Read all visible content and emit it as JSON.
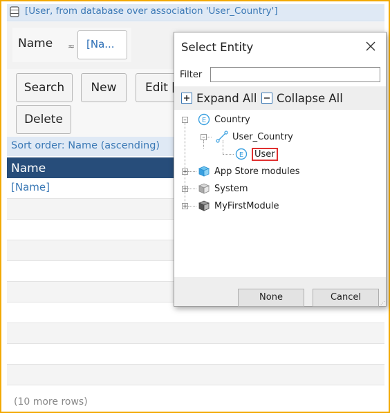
{
  "datagrid": {
    "header_title": "[User, from database over association 'User_Country']",
    "search": {
      "label": "Name",
      "operator": "≈",
      "value": "[Na..."
    },
    "buttons": {
      "search": "Search",
      "new": "New",
      "edit": "Edit [",
      "delete": "Delete"
    },
    "sort_order": "Sort order: Name (ascending)",
    "column_header": "Name",
    "first_row_value": "[Name]",
    "more_rows": "(10 more rows)"
  },
  "dialog": {
    "title": "Select Entity",
    "filter_label": "Filter",
    "filter_value": "",
    "expand_all": "Expand All",
    "collapse_all": "Collapse All",
    "tree": {
      "country": "Country",
      "user_country": "User_Country",
      "user": "User",
      "app_store_modules": "App Store modules",
      "system": "System",
      "my_first_module": "MyFirstModule"
    },
    "none_button": "None",
    "cancel_button": "Cancel"
  },
  "colors": {
    "frame_border": "#f2a900",
    "link_blue": "#3a78b5",
    "header_navy": "#274d7a",
    "selection_red": "#e03030",
    "entity_blue": "#3aa0e0"
  }
}
